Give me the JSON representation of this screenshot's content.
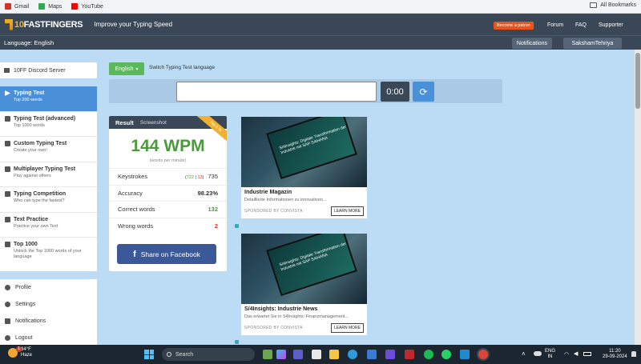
{
  "bookmarks": {
    "items": [
      {
        "label": "Gmail",
        "icon": "gmail-icon",
        "color": "#d93025"
      },
      {
        "label": "Maps",
        "icon": "maps-icon",
        "color": "#34a853"
      },
      {
        "label": "YouTube",
        "icon": "youtube-icon",
        "color": "#ff0000"
      }
    ],
    "all": "All Bookmarks"
  },
  "header": {
    "logo_a": "10",
    "logo_b": "FASTFINGERS",
    "tagline": "Improve your Typing Speed",
    "patron": "Become a patron",
    "links": [
      "Forum",
      "FAQ",
      "Supporter"
    ],
    "language_label": "Language: English",
    "notifications": "Notifications",
    "user": "SakshamTehriya"
  },
  "sidebar": {
    "discord": "10FF Discord Server",
    "menu": [
      {
        "title": "Typing Test",
        "sub": "Top 200 words",
        "active": true
      },
      {
        "title": "Typing Test (advanced)",
        "sub": "Top 1000 words"
      },
      {
        "title": "Custom Typing Test",
        "sub": "Create your own!"
      },
      {
        "title": "Multiplayer Typing Test",
        "sub": "Play against others"
      },
      {
        "title": "Typing Competition",
        "sub": "Who can type the fastest?"
      },
      {
        "title": "Text Practice",
        "sub": "Practice your own Text"
      },
      {
        "title": "Top 1000",
        "sub": "Unlock the Top 1000 words of your language"
      }
    ],
    "account": [
      "Profile",
      "Settings",
      "Notifications",
      "Logout"
    ]
  },
  "test": {
    "language_button": "English",
    "switch_label": "Switch Typing Test language",
    "input_value": "",
    "timer": "0:00"
  },
  "result": {
    "header": "Result",
    "screenshot": "Screenshot",
    "ribbon": "Top 1 %",
    "wpm": "144 WPM",
    "wpm_sub": "(words per minute)",
    "keystrokes_label": "Keystrokes",
    "keystrokes_correct": "722",
    "keystrokes_wrong": "13",
    "keystrokes_total": "735",
    "accuracy_label": "Accuracy",
    "accuracy": "98.23%",
    "correct_label": "Correct words",
    "correct": "132",
    "wrong_label": "Wrong words",
    "wrong": "2",
    "share": "Share on Facebook"
  },
  "ads": [
    {
      "title": "Industrie Magazin",
      "desc": "Detaillierte Informationen zu innovativen...",
      "sponsor": "SPONSORED BY CONVISTA",
      "cta": "LEARN MORE",
      "tablet_text": "S/4Insights: Digitale Transformation der Industrie mit SAP S/4HANA"
    },
    {
      "title": "S/4Insights: Industrie News",
      "desc": "Das erwartet Sie in S4Insights: Finanzmanagement...",
      "sponsor": "SPONSORED BY CONVISTA",
      "cta": "LEARN MORE",
      "tablet_text": "S/4Insights: Digitale Transformation der Industrie mit SAP S/4HANA"
    }
  ],
  "taskbar": {
    "temp": "84°F",
    "condition": "Haze",
    "search": "Search",
    "lang1": "ENG",
    "lang2": "IN",
    "time": "11:20",
    "date": "29-09-2024",
    "badge": "1"
  },
  "colors": {
    "header_bg": "#3a4756",
    "page_bg": "#bcdcf5",
    "wpm_green": "#4a9a3c",
    "active_blue": "#4a90d9",
    "facebook": "#3b5998"
  }
}
